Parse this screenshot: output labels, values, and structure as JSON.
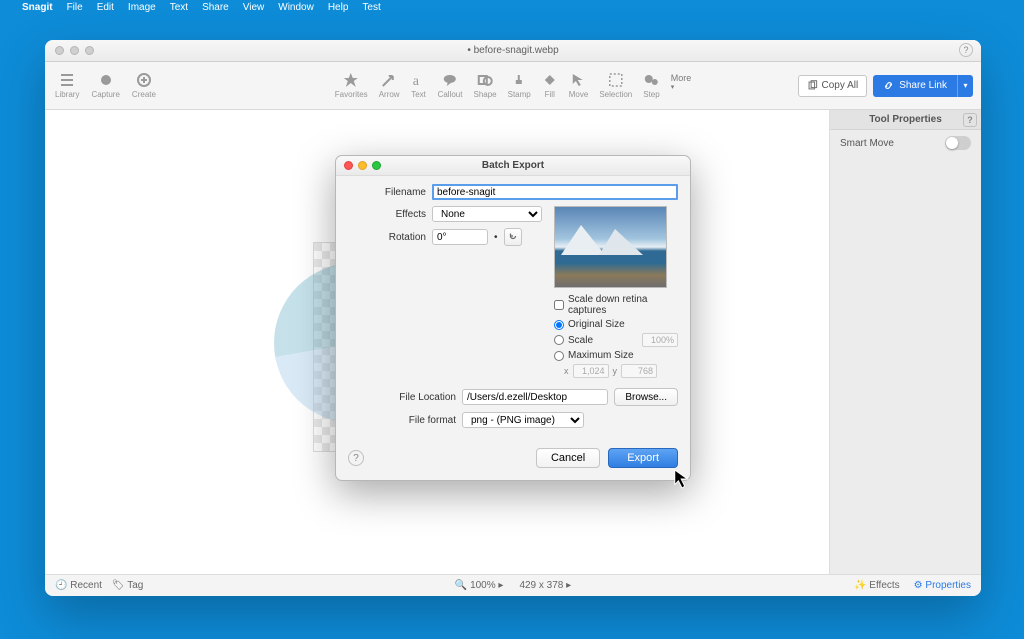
{
  "menubar": {
    "apple": "",
    "app": "Snagit",
    "items": [
      "File",
      "Edit",
      "Image",
      "Text",
      "Share",
      "View",
      "Window",
      "Help",
      "Test"
    ]
  },
  "window": {
    "title": "• before-snagit.webp"
  },
  "toolbar": {
    "left": [
      {
        "name": "library",
        "label": "Library"
      },
      {
        "name": "capture",
        "label": "Capture"
      },
      {
        "name": "create",
        "label": "Create"
      }
    ],
    "center": [
      {
        "name": "favorites",
        "label": "Favorites"
      },
      {
        "name": "arrow",
        "label": "Arrow"
      },
      {
        "name": "text",
        "label": "Text"
      },
      {
        "name": "callout",
        "label": "Callout"
      },
      {
        "name": "shape",
        "label": "Shape"
      },
      {
        "name": "stamp",
        "label": "Stamp"
      },
      {
        "name": "fill",
        "label": "Fill"
      },
      {
        "name": "move",
        "label": "Move"
      },
      {
        "name": "selection",
        "label": "Selection"
      },
      {
        "name": "step",
        "label": "Step"
      }
    ],
    "more": "More",
    "copy_all": "Copy All",
    "share_link": "Share Link"
  },
  "side_panel": {
    "title": "Tool Properties",
    "smart_move": "Smart Move"
  },
  "statusbar": {
    "recent": "Recent",
    "tag": "Tag",
    "zoom": "100% ▸",
    "dims": "429 x 378 ▸",
    "effects": "Effects",
    "properties": "Properties"
  },
  "dialog": {
    "title": "Batch Export",
    "filename_label": "Filename",
    "filename_value": "before-snagit",
    "effects_label": "Effects",
    "effects_value": "None",
    "rotation_label": "Rotation",
    "rotation_value": "0°",
    "scale_retina": "Scale down retina captures",
    "original_size": "Original Size",
    "scale_label": "Scale",
    "scale_pct": "100%",
    "max_size": "Maximum Size",
    "x_label": "x",
    "x_value": "1,024",
    "y_label": "y",
    "y_value": "768",
    "file_location_label": "File Location",
    "file_location_value": "/Users/d.ezell/Desktop",
    "browse": "Browse...",
    "file_format_label": "File format",
    "file_format_value": "png - (PNG image)",
    "help": "?",
    "cancel": "Cancel",
    "export": "Export"
  }
}
